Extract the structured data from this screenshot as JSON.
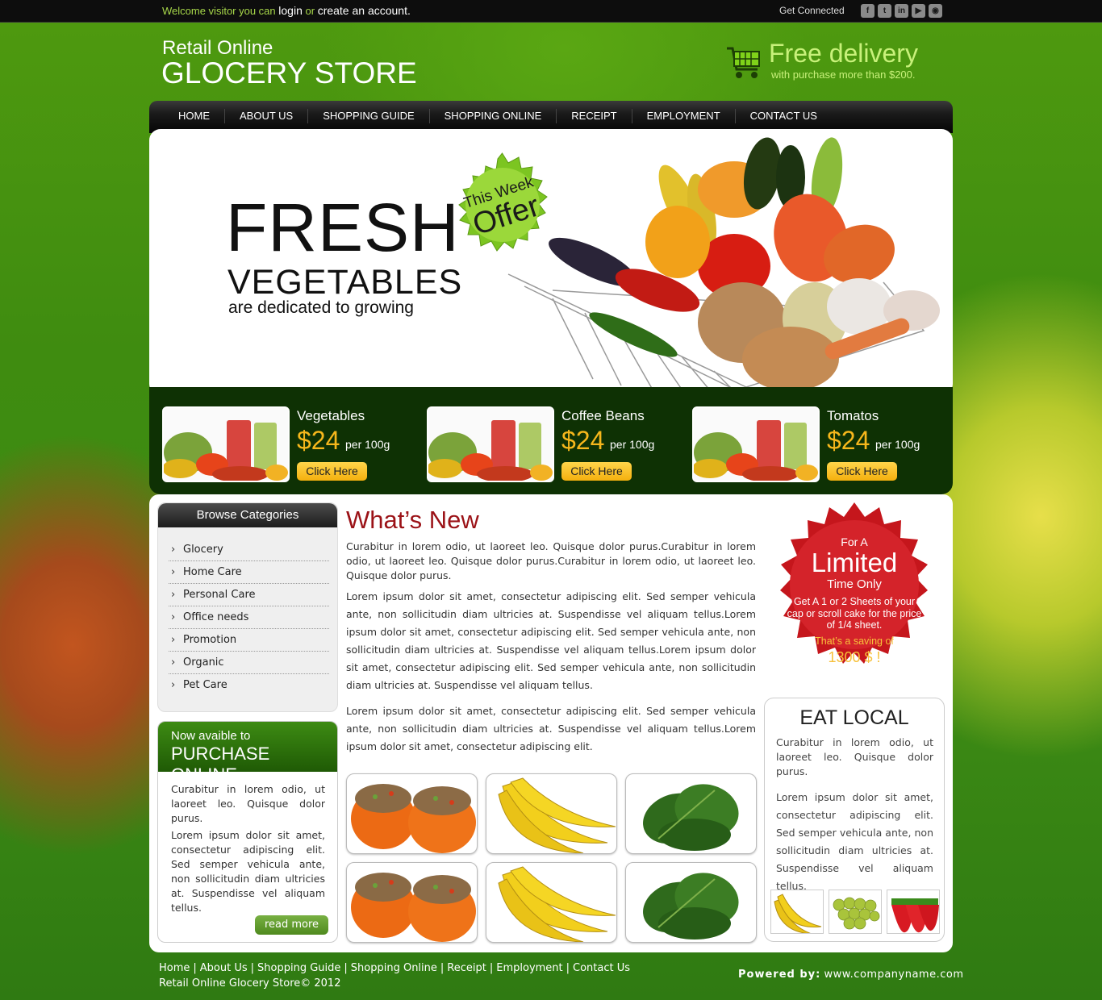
{
  "topbar": {
    "welcome_prefix": "Welcome visitor you can",
    "login_link": "login",
    "or_text": "or",
    "create_link": "create an account.",
    "get_connected": "Get Connected",
    "social": [
      {
        "icon": "facebook-icon",
        "glyph": "f"
      },
      {
        "icon": "twitter-icon",
        "glyph": "t"
      },
      {
        "icon": "linkedin-icon",
        "glyph": "in"
      },
      {
        "icon": "youtube-icon",
        "glyph": "▶"
      },
      {
        "icon": "rss-icon",
        "glyph": "◉"
      }
    ]
  },
  "brand": {
    "line1": "Retail Online",
    "line2": "GLOCERY STORE"
  },
  "delivery": {
    "title": "Free delivery",
    "subtitle": "with purchase more than $200."
  },
  "nav": [
    "HOME",
    "ABOUT US",
    "SHOPPING GUIDE",
    "SHOPPING ONLINE",
    "RECEIPT",
    "EMPLOYMENT",
    "CONTACT US"
  ],
  "hero": {
    "headline": "FRESH",
    "subheadline": "VEGETABLES",
    "tagline": "are dedicated to growing",
    "badge_line1": "This Week",
    "badge_line2": "Offer"
  },
  "products": [
    {
      "title": "Vegetables",
      "price": "$24",
      "unit": "per 100g",
      "button": "Click Here"
    },
    {
      "title": "Coffee Beans",
      "price": "$24",
      "unit": "per 100g",
      "button": "Click Here"
    },
    {
      "title": "Tomatos",
      "price": "$24",
      "unit": "per 100g",
      "button": "Click Here"
    }
  ],
  "categories": {
    "title": "Browse Categories",
    "items": [
      "Glocery",
      "Home Care",
      "Personal Care",
      "Office needs",
      "Promotion",
      "Organic",
      "Pet Care"
    ]
  },
  "purchase": {
    "line1": "Now avaible to",
    "line2": "PURCHASE ONLINE",
    "para1": "Curabitur in lorem odio, ut laoreet leo. Quisque dolor purus.",
    "para2": "Lorem ipsum dolor sit amet, consectetur adipiscing elit. Sed semper vehicula ante, non sollicitudin diam ultricies at. Suspendisse vel aliquam tellus.",
    "button": "read more"
  },
  "whats_new": {
    "title": "What’s New",
    "intro": "Curabitur in lorem odio, ut laoreet leo. Quisque dolor purus.Curabitur in lorem odio, ut laoreet leo. Quisque dolor purus.Curabitur in lorem odio, ut laoreet leo. Quisque dolor purus.",
    "para1": "Lorem ipsum dolor sit amet, consectetur adipiscing elit. Sed semper vehicula ante, non sollicitudin diam ultricies at. Suspendisse vel aliquam tellus.Lorem ipsum dolor sit amet, consectetur adipiscing elit. Sed semper vehicula ante, non sollicitudin diam ultricies at. Suspendisse vel aliquam tellus.Lorem ipsum dolor sit amet, consectetur adipiscing elit. Sed semper vehicula ante, non sollicitudin diam ultricies at. Suspendisse vel aliquam tellus.",
    "para2": "Lorem ipsum dolor sit amet, consectetur adipiscing elit. Sed semper vehicula ante, non sollicitudin diam ultricies at. Suspendisse vel aliquam tellus.Lorem ipsum dolor sit amet, consectetur adipiscing elit."
  },
  "limited": {
    "line1": "For A",
    "line2": "Limited",
    "line3": "Time Only",
    "desc": "Get A 1 or 2 Sheets of your cap or scroll cake for the price of 1/4 sheet.",
    "saving": "That’s a saving of",
    "amount": "1300 $ !"
  },
  "eat_local": {
    "title": "EAT LOCAL",
    "para1": "Curabitur in lorem odio, ut laoreet leo. Quisque dolor purus.",
    "para2": "Lorem ipsum dolor sit amet, consectetur adipiscing elit. Sed semper vehicula ante, non sollicitudin diam ultricies at. Suspendisse vel aliquam tellus."
  },
  "footer": {
    "links": [
      "Home",
      "About Us",
      "Shopping Guide",
      "Shopping Online",
      "Receipt",
      "Employment",
      "Contact Us"
    ],
    "copyright": "Retail Online Glocery Store© 2012",
    "powered_label": "Powered by:",
    "powered_url": "www.companyname.com"
  },
  "colors": {
    "accent_green": "#3d8b13",
    "dark_green": "#0e3104",
    "price_orange": "#f6b71c",
    "title_red": "#9b1217",
    "delivery_green": "#c8f17a"
  }
}
